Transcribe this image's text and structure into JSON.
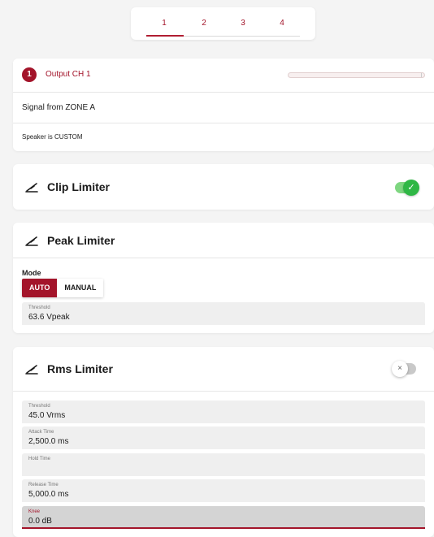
{
  "tabs": [
    "1",
    "2",
    "3",
    "4"
  ],
  "channel": {
    "badge": "1",
    "title": "Output CH 1",
    "signal": "Signal from ZONE A",
    "speaker": "Speaker is CUSTOM"
  },
  "clip_limiter": {
    "title": "Clip Limiter",
    "enabled": true,
    "toggle_glyph": "✓"
  },
  "peak_limiter": {
    "title": "Peak Limiter",
    "mode_label": "Mode",
    "modes": [
      "AUTO",
      "MANUAL"
    ],
    "selected_mode": "AUTO",
    "threshold": {
      "label": "Threshold",
      "value": "63.6  Vpeak"
    }
  },
  "rms_limiter": {
    "title": "Rms Limiter",
    "enabled": false,
    "toggle_glyph": "×",
    "fields": [
      {
        "label": "Threshold",
        "value": "45.0  Vrms"
      },
      {
        "label": "Attack Time",
        "value": "2,500.0  ms"
      },
      {
        "label": "Hold Time",
        "value": ""
      },
      {
        "label": "Release Time",
        "value": "5,000.0  ms"
      },
      {
        "label": "Knee",
        "value": "0.0  dB"
      }
    ]
  },
  "icons": {
    "limiter": "limiter-icon",
    "check": "check-icon",
    "close": "close-icon"
  },
  "colors": {
    "accent": "#a3142a",
    "toggle_on": "#2fb745"
  }
}
